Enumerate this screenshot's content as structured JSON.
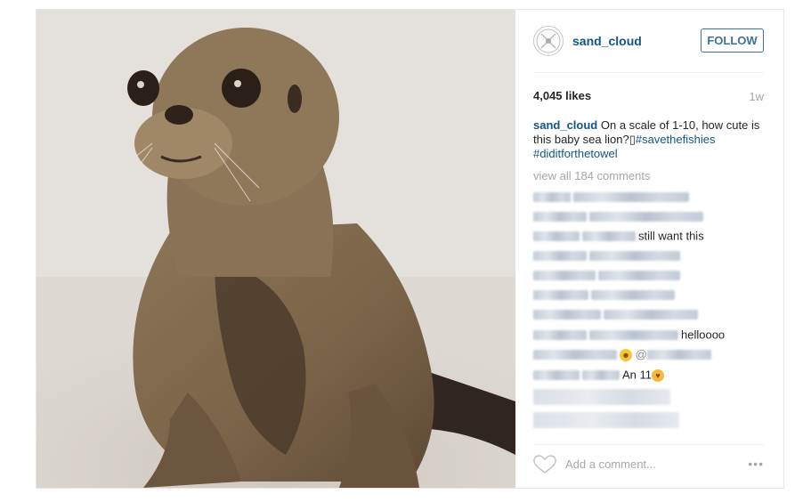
{
  "post": {
    "username": "sand_cloud",
    "follow_label": "FOLLOW",
    "likes": "4,045 likes",
    "time": "1w",
    "caption": {
      "user": "sand_cloud",
      "text": "On a scale of 1-10, how cute is this baby sea lion?",
      "glyph": "▯",
      "tag1": "#savethefishies",
      "tag2": "#diditforthetowel"
    },
    "view_all": "view all 184 comments",
    "comments": {
      "c3_text": "still want this",
      "c8_text": "helloooo",
      "c9_text": "@",
      "c10_text": "An 11"
    },
    "add_comment_placeholder": "Add a comment...",
    "more_label": "•••"
  },
  "colors": {
    "link": "#125688",
    "follow": "#3f729b",
    "muted": "#a5a7aa"
  },
  "icons": [
    "logo-icon",
    "heart-icon",
    "more-options-icon"
  ]
}
